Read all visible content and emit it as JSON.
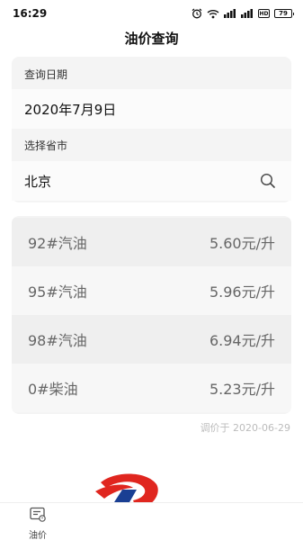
{
  "status_bar": {
    "time": "16:29",
    "battery": "79",
    "hd": "HD",
    "icons": [
      "alarm-icon",
      "wifi-icon",
      "signal-icon",
      "signal-icon",
      "hd-icon",
      "battery-icon"
    ]
  },
  "header": {
    "title": "油价查询"
  },
  "query": {
    "date_label": "查询日期",
    "date_value": "2020年7月9日",
    "province_label": "选择省市",
    "province_value": "北京",
    "search_icon": "search-icon"
  },
  "prices": [
    {
      "grade": "92#汽油",
      "price": "5.60元/升"
    },
    {
      "grade": "95#汽油",
      "price": "5.96元/升"
    },
    {
      "grade": "98#汽油",
      "price": "6.94元/升"
    },
    {
      "grade": "0#柴油",
      "price": "5.23元/升"
    }
  ],
  "update_note": "调价于 2020-06-29",
  "bottom_nav": {
    "items": [
      {
        "label": "油价",
        "icon": "oil-price-icon"
      }
    ]
  },
  "colors": {
    "card_bg": "#f4f4f4",
    "logo_red": "#e0261f",
    "logo_blue": "#1a3f93",
    "note_gray": "#bcbcbc"
  }
}
